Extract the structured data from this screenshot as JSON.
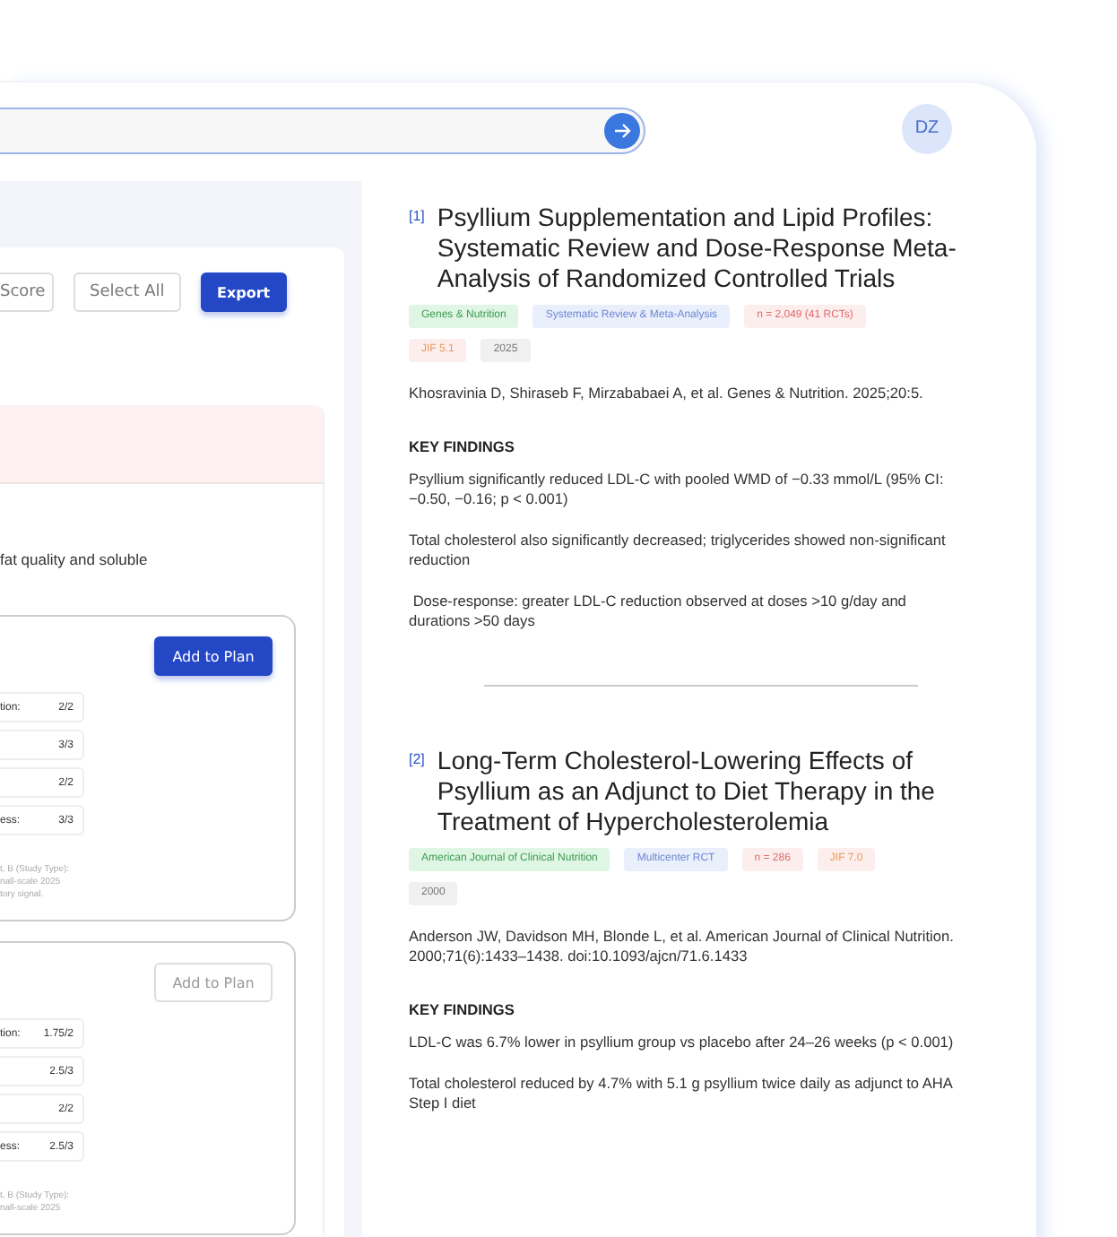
{
  "avatar": {
    "initials": "DZ"
  },
  "toolbar": {
    "buttons": [
      {
        "label": "Score",
        "kind": "cut"
      },
      {
        "label": "Select All",
        "kind": "outline"
      },
      {
        "label": "Export",
        "kind": "primary"
      }
    ]
  },
  "summary": {
    "text": "fat quality and soluble"
  },
  "cards": [
    {
      "button": {
        "label": "Add to Plan",
        "disabled": false
      },
      "scores": [
        {
          "label": "tion:",
          "value": "2/2"
        },
        {
          "value": "3/3"
        },
        {
          "value": "2/2"
        },
        {
          "label": "ess:",
          "value": "3/3"
        }
      ],
      "note": [
        "t, B (Study Type):",
        "nall-scale 2025",
        "tory signal."
      ]
    },
    {
      "button": {
        "label": "Add to Plan",
        "disabled": true
      },
      "scores": [
        {
          "label": "tion:",
          "value": "1.75/2"
        },
        {
          "value": "2.5/3"
        },
        {
          "value": "2/2"
        },
        {
          "label": "ess:",
          "value": "2.5/3"
        }
      ],
      "note": [
        "t, B (Study Type):",
        "nall-scale 2025"
      ]
    }
  ],
  "papers": [
    {
      "index": "[1]",
      "title": "Psyllium Supplementation and Lipid Profiles: Systematic Review and Dose-Response Meta-Analysis of Randomized Controlled Trials",
      "tags": [
        {
          "text": "Genes & Nutrition",
          "kind": "journal"
        },
        {
          "text": "Systematic Review & Meta-Analysis",
          "kind": "design"
        },
        {
          "text": "n = 2,049 (41 RCTs)",
          "kind": "sample"
        },
        {
          "text": "JIF 5.1",
          "kind": "impact"
        },
        {
          "text": "2025",
          "kind": "year"
        }
      ],
      "citation": "Khosravinia D, Shiraseb F, Mirzababaei A, et al. Genes & Nutrition. 2025;20:5.",
      "findings_heading": "KEY FINDINGS",
      "findings": [
        "Psyllium significantly reduced LDL-C with pooled WMD of −0.33 mmol/L (95% CI: −0.50, −0.16; p < 0.001)",
        "Total cholesterol also significantly decreased; triglycerides showed non-significant reduction",
        " Dose-response: greater LDL-C reduction observed at doses >10 g/day and durations >50 days"
      ]
    },
    {
      "index": "[2]",
      "title": "Long-Term Cholesterol-Lowering Effects of Psyllium as an Adjunct to Diet Therapy in the Treatment of Hypercholesterolemia",
      "tags": [
        {
          "text": "American Journal of Clinical Nutrition",
          "kind": "journal"
        },
        {
          "text": "Multicenter RCT",
          "kind": "design"
        },
        {
          "text": "n = 286",
          "kind": "sample"
        },
        {
          "text": "JIF 7.0",
          "kind": "impact"
        },
        {
          "text": "2000",
          "kind": "year"
        }
      ],
      "citation": "Anderson JW, Davidson MH, Blonde L, et al. American Journal of Clinical Nutrition. 2000;71(6):1433–1438. doi:10.1093/ajcn/71.6.1433",
      "findings_heading": "KEY FINDINGS",
      "findings": [
        "LDL-C was 6.7% lower in psyllium group vs placebo after 24–26 weeks (p < 0.001)",
        "Total cholesterol reduced by 4.7% with 5.1 g psyllium twice daily as adjunct to AHA Step I diet"
      ]
    }
  ]
}
